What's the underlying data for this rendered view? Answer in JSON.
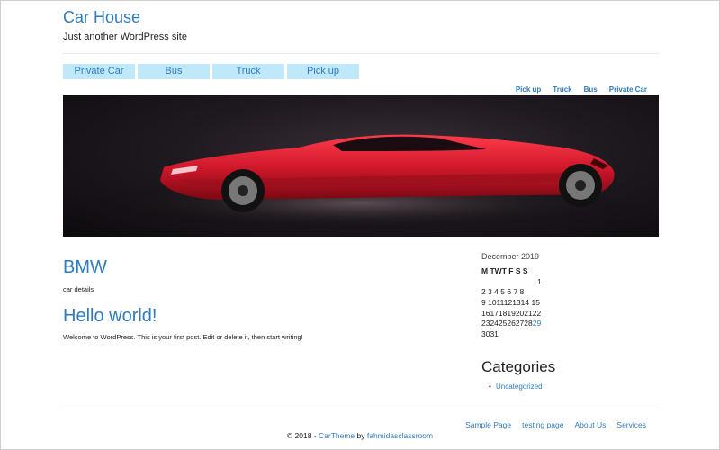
{
  "site": {
    "title": "Car House",
    "description": "Just another WordPress site"
  },
  "main_nav": [
    "Private Car",
    "Bus",
    "Truck",
    "Pick up"
  ],
  "sub_nav": [
    "Pick up",
    "Truck",
    "Bus",
    "Private Car"
  ],
  "hero_image": {
    "alt": "red sports car",
    "accent_color": "#d0182c"
  },
  "posts": [
    {
      "title": "BMW",
      "excerpt": "car details"
    },
    {
      "title": "Hello world!",
      "excerpt": "Welcome to WordPress. This is your first post. Edit or delete it, then start writing!"
    }
  ],
  "calendar": {
    "caption": "December 2019",
    "weekdays": [
      "M",
      "T",
      "W",
      "T",
      "F",
      "S",
      "S"
    ],
    "rows": [
      "1",
      "2345678",
      "91011121314 15",
      "16171819202122",
      "23242526272829",
      "3031"
    ],
    "row_1": "1",
    "row_2": "2 3 4 5 6 7 8",
    "row_3": "9 1011121314 15",
    "row_4": "16171819202122",
    "row_5_prefix": "232425262728",
    "row_5_link": "29",
    "row_6": "3031"
  },
  "categories": {
    "title": "Categories",
    "items": [
      "Uncategorized"
    ]
  },
  "footer": {
    "nav": [
      "Sample Page",
      "testing page",
      "About Us",
      "Services"
    ],
    "copyright_prefix": "© 2018 - ",
    "theme_link": "CarTheme",
    "by_text": " by ",
    "author_link": "fahmidasclassroom"
  },
  "colors": {
    "link": "#2f7bbf",
    "nav_bg": "#bfe9fb"
  }
}
